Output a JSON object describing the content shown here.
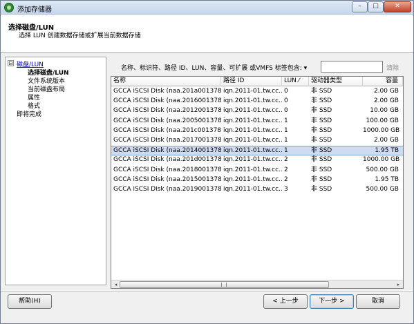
{
  "window": {
    "title": "添加存储器",
    "min": "–",
    "max": "□",
    "close": "✕"
  },
  "header": {
    "title": "选择磁盘/LUN",
    "subtitle": "选择 LUN 创建数据存储或扩展当前数据存储"
  },
  "nav": {
    "toggle": "⊟",
    "items": [
      {
        "label": "磁盘/LUN"
      },
      {
        "label": "选择磁盘/LUN"
      },
      {
        "label": "文件系统版本"
      },
      {
        "label": "当前磁盘布局"
      },
      {
        "label": "属性"
      },
      {
        "label": "格式"
      },
      {
        "label": "即将完成"
      }
    ]
  },
  "filter": {
    "label": "名称、标识符、路径 ID、LUN、容量、可扩展 或VMFS 标签包含: ▾",
    "value": "",
    "clear": "清除"
  },
  "table": {
    "columns": [
      "名称",
      "路径 ID",
      "LUN ⁄",
      "驱动器类型",
      "容量"
    ],
    "rows": [
      [
        "GCCA iSCSI Disk (naa.201a0013789...",
        "iqn.2011-01.tw.cc...",
        "0",
        "非 SSD",
        "2.00 GB"
      ],
      [
        "GCCA iSCSI Disk (naa.20160013789...",
        "iqn.2011-01.tw.cc...",
        "0",
        "非 SSD",
        "2.00 GB"
      ],
      [
        "GCCA iSCSI Disk (naa.20120013789...",
        "iqn.2011-01.tw.cc...",
        "0",
        "非 SSD",
        "10.00 GB"
      ],
      [
        "GCCA iSCSI Disk (naa.20050013789...",
        "iqn.2011-01.tw.cc...",
        "1",
        "非 SSD",
        "100.00 GB"
      ],
      [
        "GCCA iSCSI Disk (naa.201c0013789...",
        "iqn.2011-01.tw.cc...",
        "1",
        "非 SSD",
        "1000.00 GB"
      ],
      [
        "GCCA iSCSI Disk (naa.20170013789...",
        "iqn.2011-01.tw.cc...",
        "1",
        "非 SSD",
        "2.00 GB"
      ],
      [
        "GCCA iSCSI Disk (naa.20140013789...",
        "iqn.2011-01.tw.cc...",
        "1",
        "非 SSD",
        "1.95 TB"
      ],
      [
        "GCCA iSCSI Disk (naa.201d0013789...",
        "iqn.2011-01.tw.cc...",
        "2",
        "非 SSD",
        "1000.00 GB"
      ],
      [
        "GCCA iSCSI Disk (naa.20180013789...",
        "iqn.2011-01.tw.cc...",
        "2",
        "非 SSD",
        "500.00 GB"
      ],
      [
        "GCCA iSCSI Disk (naa.20150013789...",
        "iqn.2011-01.tw.cc...",
        "2",
        "非 SSD",
        "1.95 TB"
      ],
      [
        "GCCA iSCSI Disk (naa.20190013789...",
        "iqn.2011-01.tw.cc...",
        "3",
        "非 SSD",
        "500.00 GB"
      ]
    ],
    "selected_row": 6,
    "scroll_left": "◂",
    "scroll_right": "▸"
  },
  "buttons": {
    "help": "帮助(H)",
    "prev": "< 上一步",
    "next": "下一步 >",
    "cancel": "取消"
  },
  "colors": {
    "selection": "#cddcf1",
    "link": "#0000cc"
  }
}
